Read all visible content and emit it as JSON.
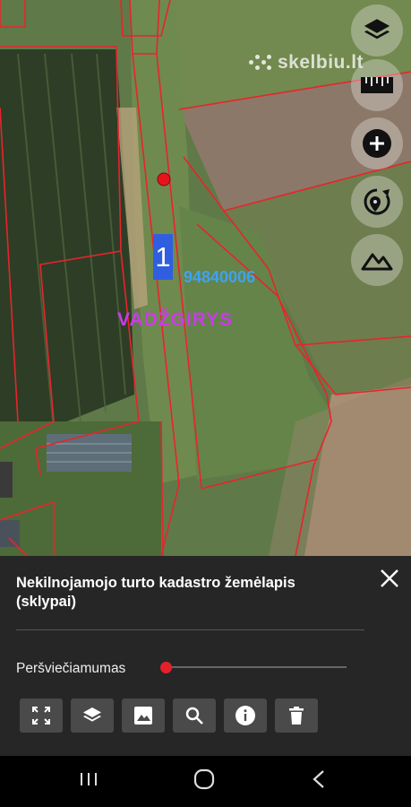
{
  "map": {
    "watermark": "skelbiu.lt",
    "plot_number": "1",
    "plot_code": "94840006",
    "place_name": "VADŽGIRYS",
    "controls": [
      "layers-icon",
      "ruler-icon",
      "zoom-in-icon",
      "rotate-location-icon",
      "terrain-icon"
    ],
    "boundary_color": "#e8242c",
    "marker_color": "#e8141c"
  },
  "panel": {
    "title": "Nekilnojamojo turto kadastro žemėlapis (sklypai)",
    "opacity_label": "Peršviečiamumas",
    "opacity_value": 0,
    "tools": [
      "fullscreen-icon",
      "layers-icon",
      "image-icon",
      "search-icon",
      "info-icon",
      "delete-icon"
    ]
  },
  "navbar": {
    "buttons": [
      "recent-apps-icon",
      "home-icon",
      "back-icon"
    ]
  }
}
